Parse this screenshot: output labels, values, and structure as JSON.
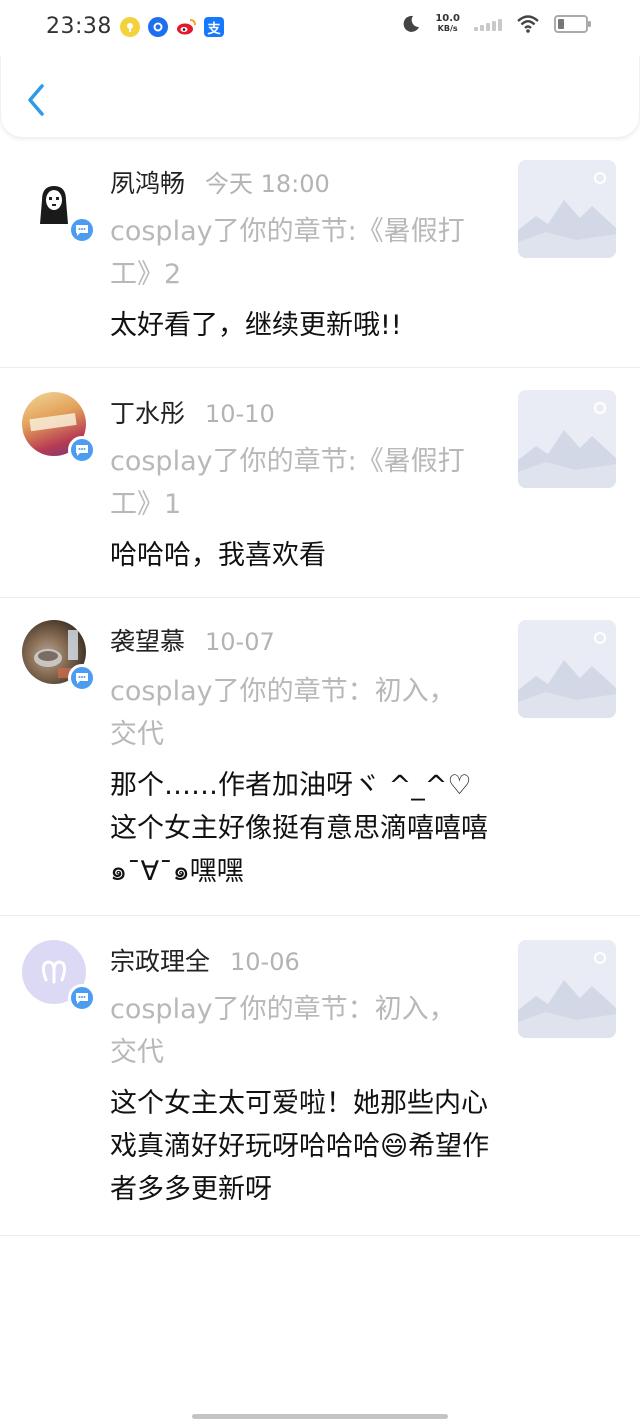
{
  "status_bar": {
    "time": "23:38",
    "net_speed_value": "10.0",
    "net_speed_unit": "KB/s",
    "icons": [
      "notification-app-icon",
      "message-app-icon",
      "weibo-icon",
      "alipay-icon",
      "moon-icon",
      "wifi-icon",
      "battery-icon"
    ],
    "alipay_glyph": "支"
  },
  "nav": {
    "back_icon": "chevron-left-icon"
  },
  "colors": {
    "accent": "#4a9df0",
    "muted": "#b8b8b8",
    "text": "#111111"
  },
  "items": [
    {
      "name": "夙鸿畅",
      "time": "今天 18:00",
      "action": "cosplay了你的章节:《暑假打工》2",
      "comment": "太好看了，继续更新哦!!"
    },
    {
      "name": "丁水彤",
      "time": "10-10",
      "action": "cosplay了你的章节:《暑假打工》1",
      "comment": "哈哈哈，我喜欢看"
    },
    {
      "name": "袭望慕",
      "time": "10-07",
      "action": "cosplay了你的章节：初入，交代",
      "comment": "那个……作者加油呀ヾ ^_^♡ 这个女主好像挺有意思滴嘻嘻嘻๑¯∀¯๑嘿嘿"
    },
    {
      "name": "宗政理全",
      "time": "10-06",
      "action": "cosplay了你的章节：初入，交代",
      "comment": "这个女主太可爱啦！她那些内心戏真滴好好玩呀哈哈哈😄希望作者多多更新呀"
    }
  ]
}
